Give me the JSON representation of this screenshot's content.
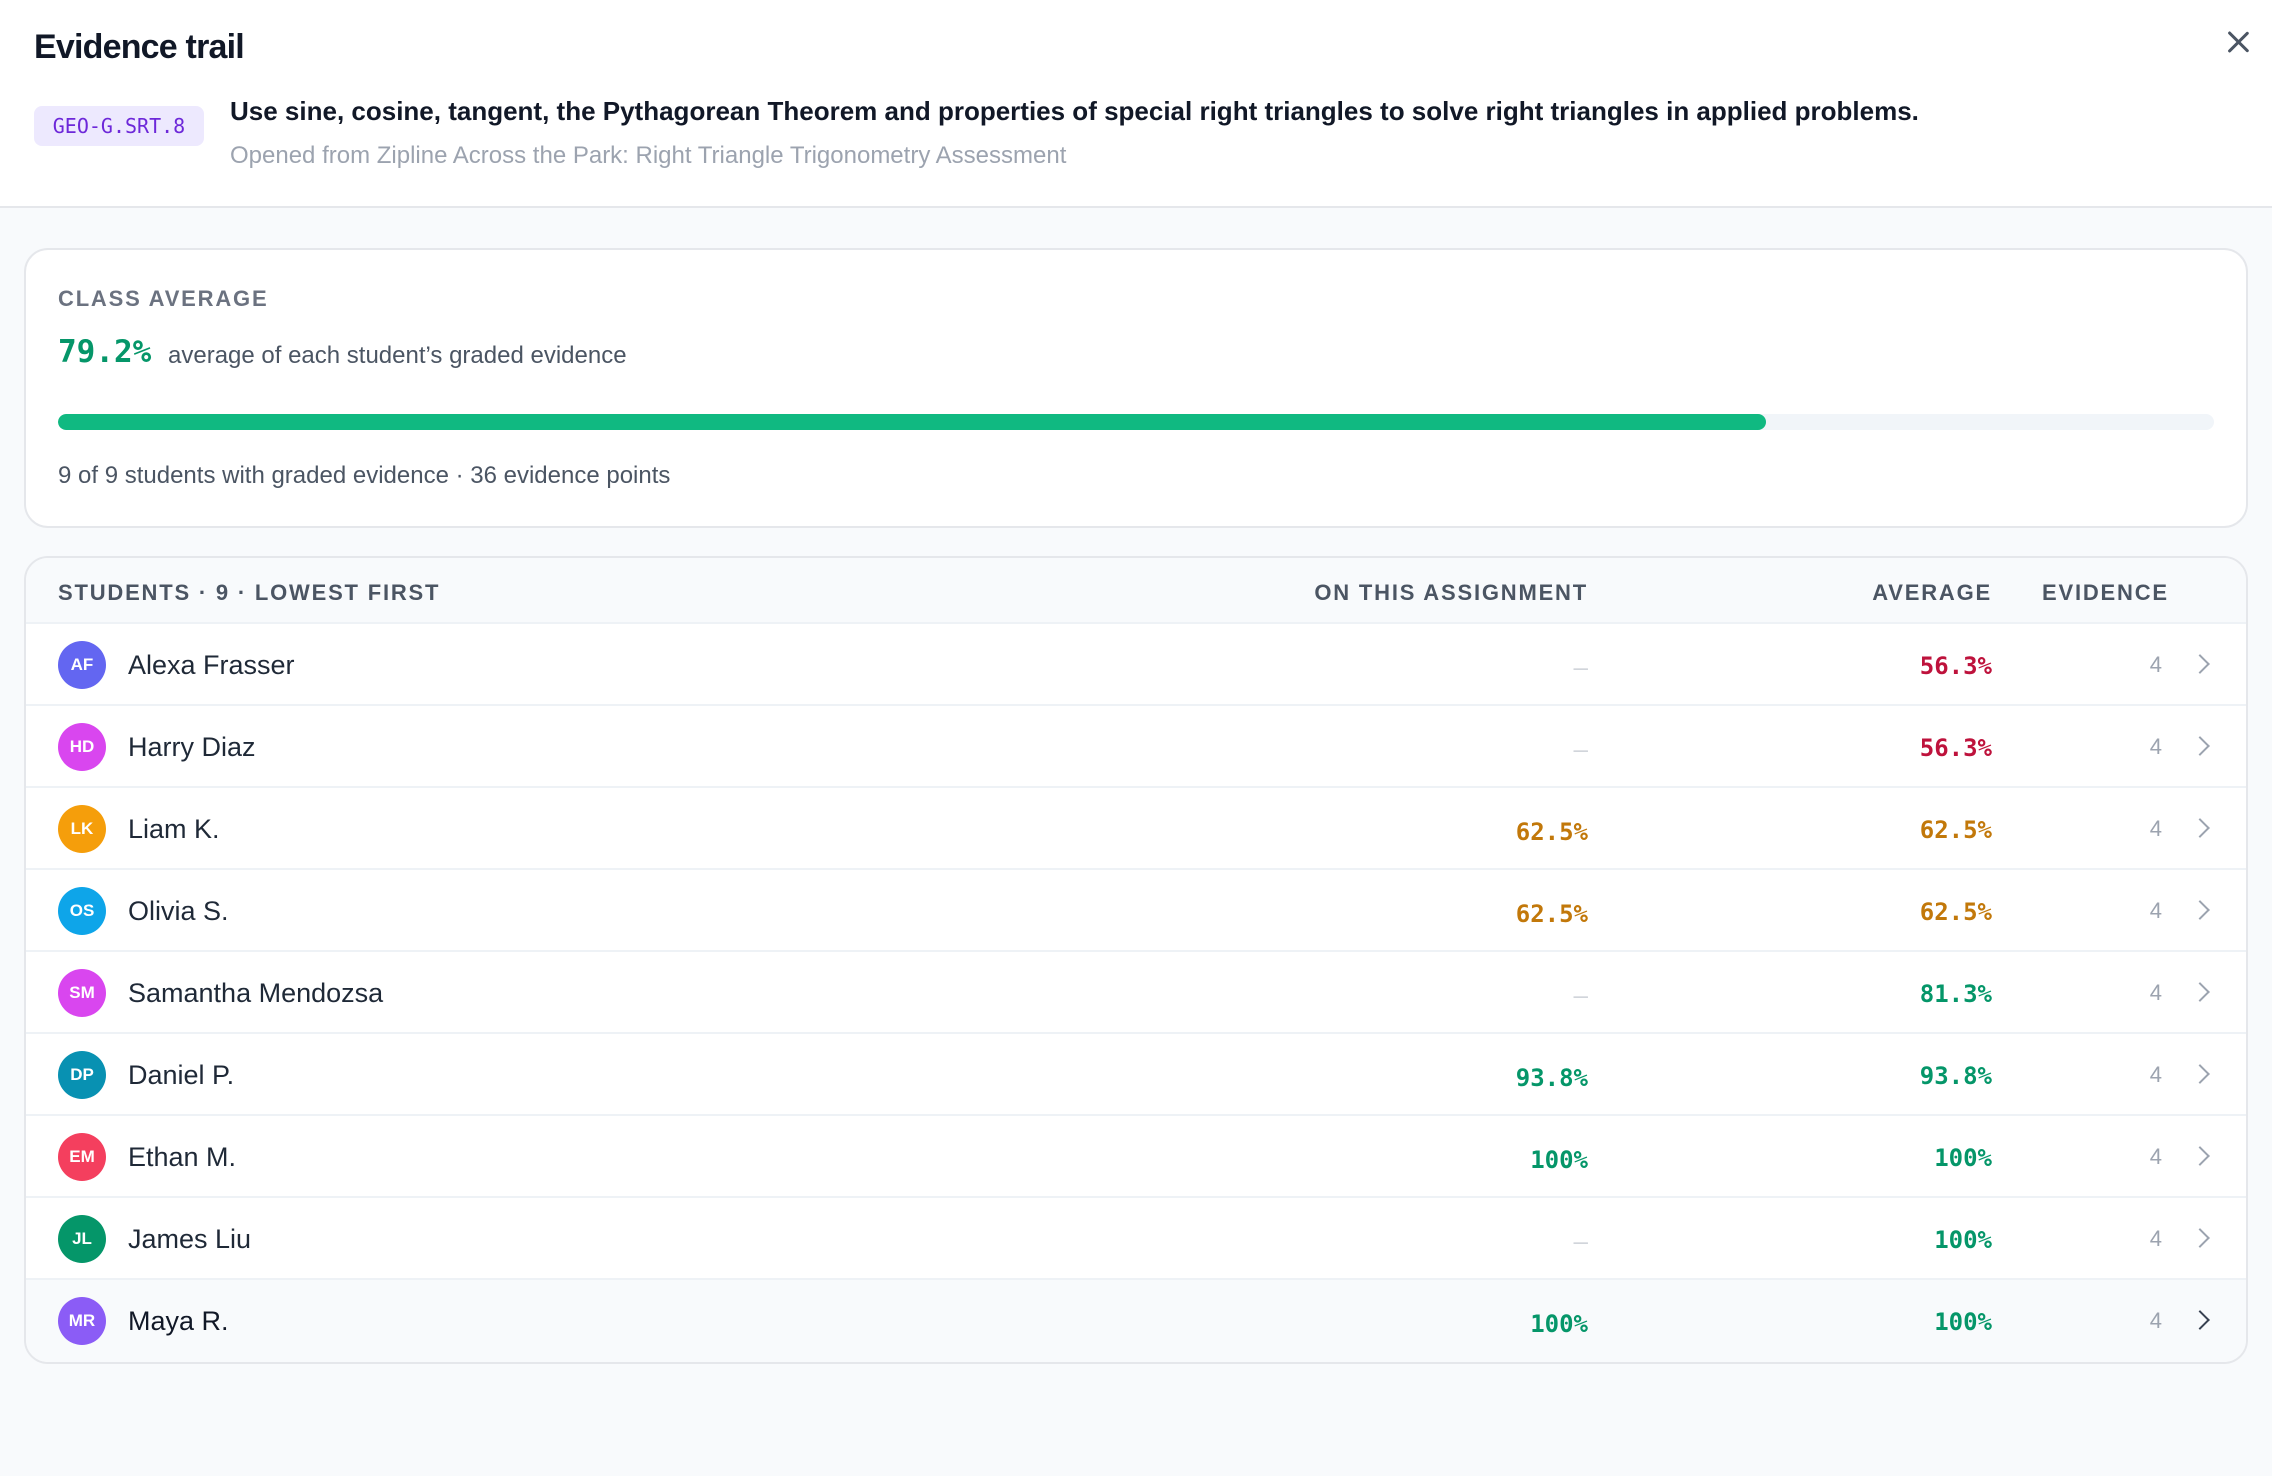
{
  "header": {
    "title": "Evidence trail",
    "close_icon": "close-icon",
    "standard_code": "GEO-G.SRT.8",
    "standard_text": "Use sine, cosine, tangent, the Pythagorean Theorem and properties of special right triangles to solve right triangles in applied problems.",
    "opened_from": "Opened from Zipline Across the Park: Right Triangle Trigonometry Assessment"
  },
  "class_average": {
    "label": "CLASS AVERAGE",
    "value": "79.2%",
    "value_fraction": 0.792,
    "description": "average of each student’s graded evidence",
    "footer": "9 of 9 students with graded evidence · 36 evidence points"
  },
  "table": {
    "headers": {
      "students": "STUDENTS · 9 · LOWEST FIRST",
      "assignment": "ON THIS ASSIGNMENT",
      "average": "AVERAGE",
      "evidence": "EVIDENCE"
    },
    "rows": [
      {
        "initials": "AF",
        "name": "Alexa Frasser",
        "assignment": "–",
        "average": "56.3%",
        "evidence": "4"
      },
      {
        "initials": "HD",
        "name": "Harry Diaz",
        "assignment": "–",
        "average": "56.3%",
        "evidence": "4"
      },
      {
        "initials": "LK",
        "name": "Liam K.",
        "assignment": "62.5%",
        "average": "62.5%",
        "evidence": "4"
      },
      {
        "initials": "OS",
        "name": "Olivia S.",
        "assignment": "62.5%",
        "average": "62.5%",
        "evidence": "4"
      },
      {
        "initials": "SM",
        "name": "Samantha Mendozsa",
        "assignment": "–",
        "average": "81.3%",
        "evidence": "4"
      },
      {
        "initials": "DP",
        "name": "Daniel P.",
        "assignment": "93.8%",
        "average": "93.8%",
        "evidence": "4"
      },
      {
        "initials": "EM",
        "name": "Ethan M.",
        "assignment": "100%",
        "average": "100%",
        "evidence": "4"
      },
      {
        "initials": "JL",
        "name": "James Liu",
        "assignment": "–",
        "average": "100%",
        "evidence": "4"
      },
      {
        "initials": "MR",
        "name": "Maya R.",
        "assignment": "100%",
        "average": "100%",
        "evidence": "4"
      }
    ]
  },
  "colors": {
    "accent_green": "#059669",
    "bar_green": "#10b981",
    "low_red": "#be123c",
    "mid_amber": "#c2780a",
    "badge_bg": "#ede9fe",
    "badge_text": "#6d28d9",
    "avatars": [
      "#6366f1",
      "#d946ef",
      "#f59e0b",
      "#0ea5e9",
      "#d946ef",
      "#0891b2",
      "#f43f5e",
      "#059669",
      "#8b5cf6"
    ]
  }
}
